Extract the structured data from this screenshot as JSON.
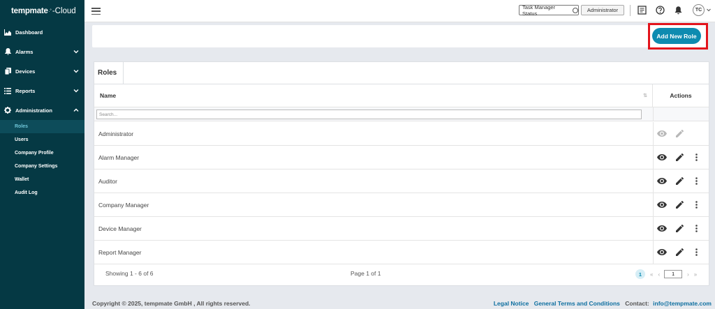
{
  "app": {
    "logo_main": "tempmate",
    "logo_sup": ".°",
    "logo_suffix": "-Cloud"
  },
  "sidebar": {
    "items": [
      {
        "label": "Dashboard",
        "icon": "dashboard-icon"
      },
      {
        "label": "Alarms",
        "icon": "bell-icon"
      },
      {
        "label": "Devices",
        "icon": "device-icon"
      },
      {
        "label": "Reports",
        "icon": "list-icon"
      },
      {
        "label": "Administration",
        "icon": "gear-icon"
      }
    ],
    "subitems": [
      "Roles",
      "Users",
      "Company Profile",
      "Company Settings",
      "Wallet",
      "Audit Log"
    ]
  },
  "topbar": {
    "task_status": "Task Manager Status",
    "role_button": "Administrator",
    "avatar": "TC"
  },
  "actions": {
    "add_role": "Add New Role"
  },
  "roles": {
    "title": "Roles",
    "col_name": "Name",
    "col_actions": "Actions",
    "search_placeholder": "Search...",
    "rows": [
      "Administrator",
      "Alarm Manager",
      "Auditor",
      "Company Manager",
      "Device Manager",
      "Report Manager"
    ],
    "showing": "Showing 1 - 6 of 6",
    "page_of": "Page 1 of 1",
    "current_page": "1",
    "page_input": "1"
  },
  "footer": {
    "copyright": "Copyright © 2025, tempmate GmbH , All rights reserved.",
    "legal": "Legal Notice",
    "terms": "General Terms and Conditions",
    "contact_label": "Contact:",
    "email": "info@tempmate.com"
  },
  "colors": {
    "sidebar": "#053944",
    "accent": "#0e8bb0",
    "highlight": "#e3141c"
  }
}
